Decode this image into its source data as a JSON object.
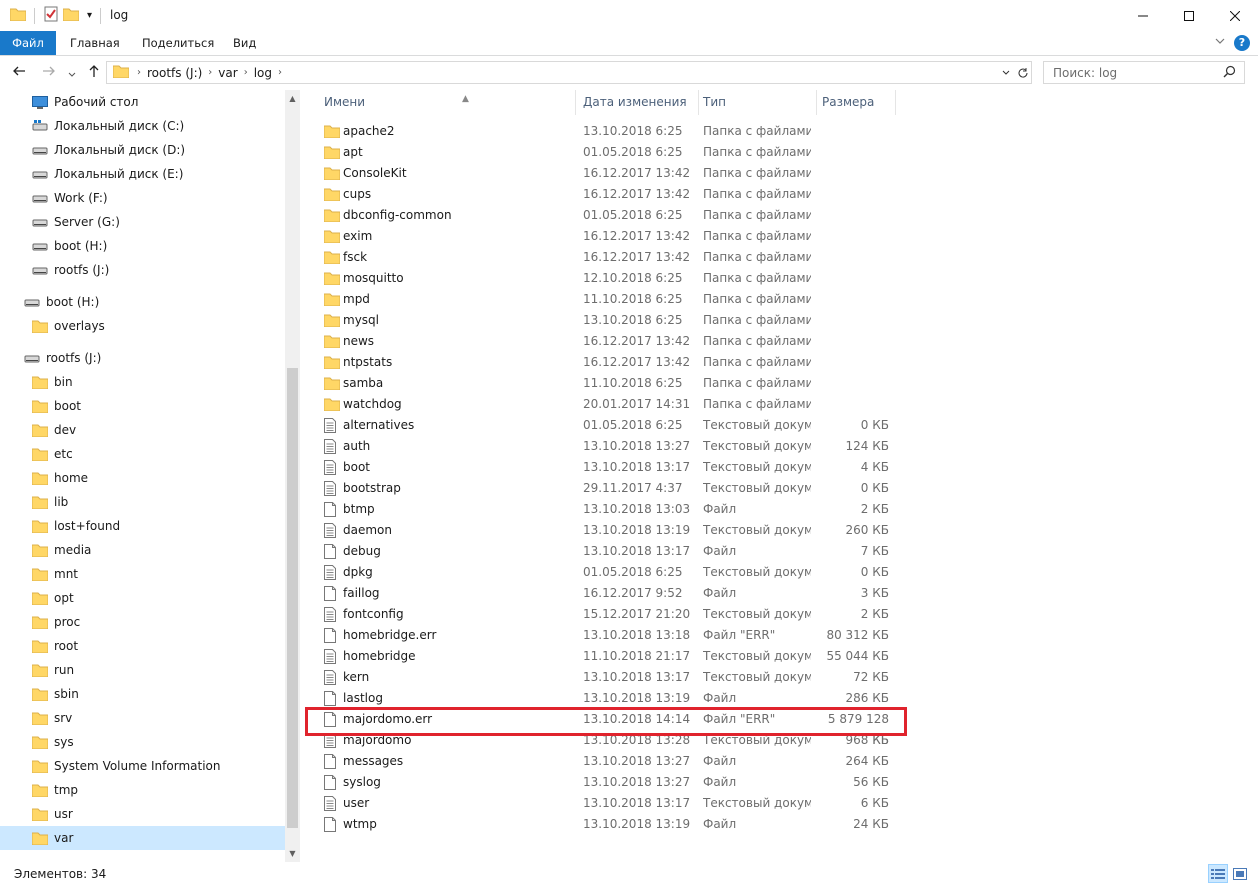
{
  "window": {
    "title": "log"
  },
  "titlebar": {
    "dropdown": "▾"
  },
  "ribbon": {
    "tabs": [
      "Файл",
      "Главная",
      "Поделиться",
      "Вид"
    ]
  },
  "address": {
    "crumbs": [
      "rootfs (J:)",
      "var",
      "log"
    ],
    "search_placeholder": "Поиск: log"
  },
  "nav": {
    "items": [
      {
        "label": "Рабочий стол",
        "icon": "desktop-icon"
      },
      {
        "label": "Локальный диск (C:)",
        "icon": "drive-icon"
      },
      {
        "label": "Локальный диск (D:)",
        "icon": "drive-icon"
      },
      {
        "label": "Локальный диск (E:)",
        "icon": "drive-icon"
      },
      {
        "label": "Work (F:)",
        "icon": "drive-icon"
      },
      {
        "label": "Server (G:)",
        "icon": "drive-icon"
      },
      {
        "label": "boot (H:)",
        "icon": "drive-icon"
      },
      {
        "label": "rootfs (J:)",
        "icon": "drive-icon"
      }
    ],
    "boot_group": {
      "label": "boot (H:)",
      "children": [
        "overlays"
      ]
    },
    "rootfs_group": {
      "label": "rootfs (J:)",
      "children": [
        "bin",
        "boot",
        "dev",
        "etc",
        "home",
        "lib",
        "lost+found",
        "media",
        "mnt",
        "opt",
        "proc",
        "root",
        "run",
        "sbin",
        "srv",
        "sys",
        "System Volume Information",
        "tmp",
        "usr",
        "var"
      ],
      "selected": "var"
    }
  },
  "columns": {
    "name": "Имени",
    "date": "Дата изменения",
    "type": "Тип",
    "size": "Размера"
  },
  "files": [
    {
      "name": "apache2",
      "date": "13.10.2018 6:25",
      "type": "Папка с файлами",
      "size": "",
      "kind": "folder"
    },
    {
      "name": "apt",
      "date": "01.05.2018 6:25",
      "type": "Папка с файлами",
      "size": "",
      "kind": "folder"
    },
    {
      "name": "ConsoleKit",
      "date": "16.12.2017 13:42",
      "type": "Папка с файлами",
      "size": "",
      "kind": "folder"
    },
    {
      "name": "cups",
      "date": "16.12.2017 13:42",
      "type": "Папка с файлами",
      "size": "",
      "kind": "folder"
    },
    {
      "name": "dbconfig-common",
      "date": "01.05.2018 6:25",
      "type": "Папка с файлами",
      "size": "",
      "kind": "folder"
    },
    {
      "name": "exim",
      "date": "16.12.2017 13:42",
      "type": "Папка с файлами",
      "size": "",
      "kind": "folder"
    },
    {
      "name": "fsck",
      "date": "16.12.2017 13:42",
      "type": "Папка с файлами",
      "size": "",
      "kind": "folder"
    },
    {
      "name": "mosquitto",
      "date": "12.10.2018 6:25",
      "type": "Папка с файлами",
      "size": "",
      "kind": "folder"
    },
    {
      "name": "mpd",
      "date": "11.10.2018 6:25",
      "type": "Папка с файлами",
      "size": "",
      "kind": "folder"
    },
    {
      "name": "mysql",
      "date": "13.10.2018 6:25",
      "type": "Папка с файлами",
      "size": "",
      "kind": "folder"
    },
    {
      "name": "news",
      "date": "16.12.2017 13:42",
      "type": "Папка с файлами",
      "size": "",
      "kind": "folder"
    },
    {
      "name": "ntpstats",
      "date": "16.12.2017 13:42",
      "type": "Папка с файлами",
      "size": "",
      "kind": "folder"
    },
    {
      "name": "samba",
      "date": "11.10.2018 6:25",
      "type": "Папка с файлами",
      "size": "",
      "kind": "folder"
    },
    {
      "name": "watchdog",
      "date": "20.01.2017 14:31",
      "type": "Папка с файлами",
      "size": "",
      "kind": "folder"
    },
    {
      "name": "alternatives",
      "date": "01.05.2018 6:25",
      "type": "Текстовый докум...",
      "size": "0 КБ",
      "kind": "text"
    },
    {
      "name": "auth",
      "date": "13.10.2018 13:27",
      "type": "Текстовый докум...",
      "size": "124 КБ",
      "kind": "text"
    },
    {
      "name": "boot",
      "date": "13.10.2018 13:17",
      "type": "Текстовый докум...",
      "size": "4 КБ",
      "kind": "text"
    },
    {
      "name": "bootstrap",
      "date": "29.11.2017 4:37",
      "type": "Текстовый докум...",
      "size": "0 КБ",
      "kind": "text"
    },
    {
      "name": "btmp",
      "date": "13.10.2018 13:03",
      "type": "Файл",
      "size": "2 КБ",
      "kind": "file"
    },
    {
      "name": "daemon",
      "date": "13.10.2018 13:19",
      "type": "Текстовый докум...",
      "size": "260 КБ",
      "kind": "text"
    },
    {
      "name": "debug",
      "date": "13.10.2018 13:17",
      "type": "Файл",
      "size": "7 КБ",
      "kind": "file"
    },
    {
      "name": "dpkg",
      "date": "01.05.2018 6:25",
      "type": "Текстовый докум...",
      "size": "0 КБ",
      "kind": "text"
    },
    {
      "name": "faillog",
      "date": "16.12.2017 9:52",
      "type": "Файл",
      "size": "3 КБ",
      "kind": "file"
    },
    {
      "name": "fontconfig",
      "date": "15.12.2017 21:20",
      "type": "Текстовый докум...",
      "size": "2 КБ",
      "kind": "text"
    },
    {
      "name": "homebridge.err",
      "date": "13.10.2018 13:18",
      "type": "Файл \"ERR\"",
      "size": "80 312 КБ",
      "kind": "file"
    },
    {
      "name": "homebridge",
      "date": "11.10.2018 21:17",
      "type": "Текстовый докум...",
      "size": "55 044 КБ",
      "kind": "text"
    },
    {
      "name": "kern",
      "date": "13.10.2018 13:17",
      "type": "Текстовый докум...",
      "size": "72 КБ",
      "kind": "text"
    },
    {
      "name": "lastlog",
      "date": "13.10.2018 13:19",
      "type": "Файл",
      "size": "286 КБ",
      "kind": "file"
    },
    {
      "name": "majordomo.err",
      "date": "13.10.2018 14:14",
      "type": "Файл \"ERR\"",
      "size": "5 879 128 КБ",
      "kind": "file"
    },
    {
      "name": "majordomo",
      "date": "13.10.2018 13:28",
      "type": "Текстовый докум...",
      "size": "968 КБ",
      "kind": "text"
    },
    {
      "name": "messages",
      "date": "13.10.2018 13:27",
      "type": "Файл",
      "size": "264 КБ",
      "kind": "file"
    },
    {
      "name": "syslog",
      "date": "13.10.2018 13:27",
      "type": "Файл",
      "size": "56 КБ",
      "kind": "file"
    },
    {
      "name": "user",
      "date": "13.10.2018 13:17",
      "type": "Текстовый докум...",
      "size": "6 КБ",
      "kind": "text"
    },
    {
      "name": "wtmp",
      "date": "13.10.2018 13:19",
      "type": "Файл",
      "size": "24 КБ",
      "kind": "file"
    }
  ],
  "status": {
    "count": "Элементов: 34"
  },
  "colors": {
    "accent": "#1979ca",
    "selection": "#cce8ff",
    "highlight": "#e0232d",
    "folder": "#ffd766"
  }
}
